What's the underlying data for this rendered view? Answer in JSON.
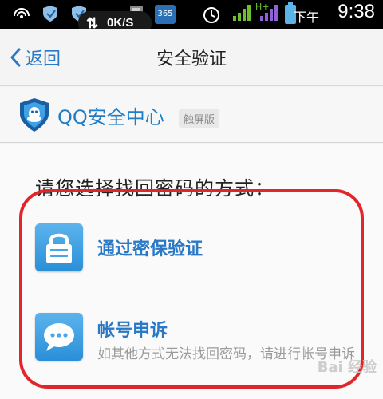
{
  "statusbar": {
    "net_speed": "0K/S",
    "ampm": "下午",
    "time": "9:38",
    "network_type": "H+",
    "app_badge": "365"
  },
  "titlebar": {
    "back_label": "返回",
    "title": "安全验证"
  },
  "brand": {
    "name": "QQ安全中心",
    "tag": "触屏版"
  },
  "content": {
    "prompt": "请您选择找回密码的方式：",
    "options": [
      {
        "title": "通过密保验证",
        "icon": "lock-icon"
      },
      {
        "title": "帐号申诉",
        "description": "如其他方式无法找回密码，请进行帐号申诉",
        "icon": "chat-bubble-icon"
      }
    ]
  },
  "watermark": "Bai 经验",
  "colors": {
    "accent": "#2a79c6",
    "highlight": "#e1252b",
    "icon_blue": "#2a8fd8"
  }
}
